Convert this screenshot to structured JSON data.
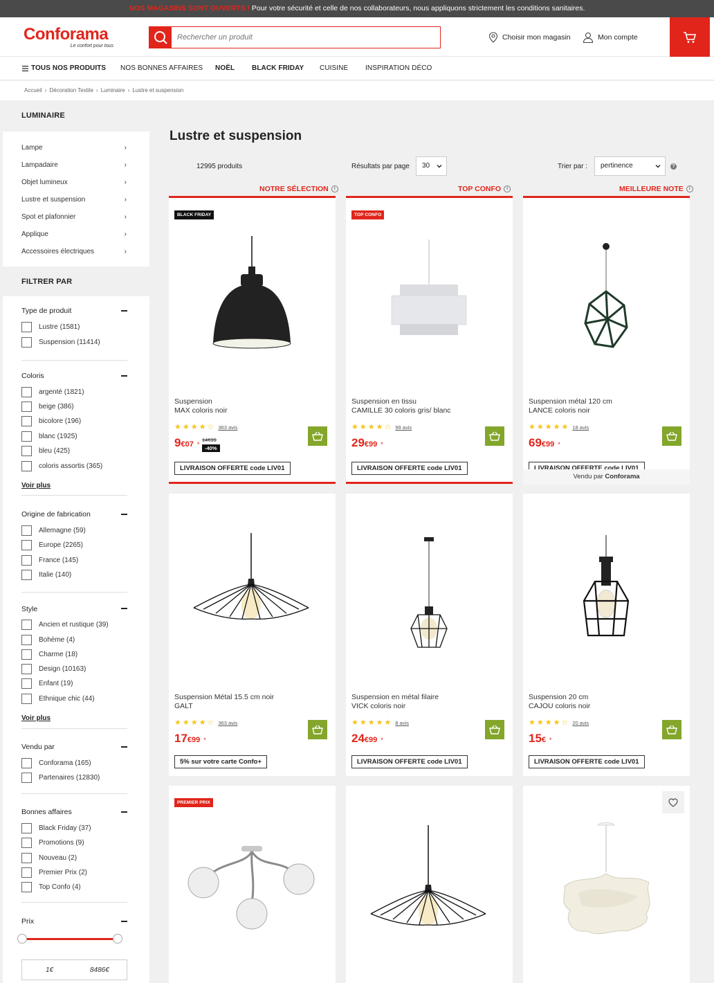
{
  "topbar": {
    "alert": "NOS MAGASINS SONT OUVERTS !",
    "message": " Pour votre sécurité et celle de nos collaborateurs, nous appliquons strictement les conditions sanitaires."
  },
  "header": {
    "brand": "Conforama",
    "tagline": "Le confort pour tous",
    "search_placeholder": "Rechercher un produit",
    "store_label": "Choisir mon magasin",
    "account_label": "Mon compte"
  },
  "nav": {
    "all_products": "TOUS NOS PRODUITS",
    "items": [
      "NOS BONNES AFFAIRES",
      "NOËL",
      "BLACK FRIDAY",
      "CUISINE",
      "INSPIRATION DÉCO"
    ]
  },
  "breadcrumb": [
    "Accueil",
    "Décoration Textile",
    "Luminaire",
    "Lustre et suspension"
  ],
  "sidebar": {
    "title": "LUMINAIRE",
    "categories": [
      "Lampe",
      "Lampadaire",
      "Objet lumineux",
      "Lustre et suspension",
      "Spot et plafonnier",
      "Applique",
      "Accessoires électriques"
    ],
    "filter_title": "FILTRER PAR",
    "groups": {
      "type": {
        "title": "Type de produit",
        "options": [
          "Lustre (1581)",
          "Suspension (11414)"
        ]
      },
      "coloris": {
        "title": "Coloris",
        "options": [
          "argenté (1821)",
          "beige (386)",
          "bicolore (196)",
          "blanc (1925)",
          "bleu (425)",
          "coloris assortis (365)"
        ],
        "more": "Voir plus"
      },
      "origine": {
        "title": "Origine de fabrication",
        "options": [
          "Allemagne (59)",
          "Europe (2265)",
          "France (145)",
          "Italie (140)"
        ]
      },
      "style": {
        "title": "Style",
        "options": [
          "Ancien et rustique (39)",
          "Bohème (4)",
          "Charme (18)",
          "Design (10163)",
          "Enfant (19)",
          "Ethnique chic (44)"
        ],
        "more": "Voir plus"
      },
      "vendu": {
        "title": "Vendu par",
        "options": [
          "Conforama (165)",
          "Partenaires (12830)"
        ]
      },
      "bonnes": {
        "title": "Bonnes affaires",
        "options": [
          "Black Friday (37)",
          "Promotions (9)",
          "Nouveau (2)",
          "Premier Prix (2)",
          "Top Confo (4)"
        ]
      },
      "prix": {
        "title": "Prix",
        "min": "1€",
        "max": "8486€"
      }
    }
  },
  "listing": {
    "title": "Lustre et suspension",
    "count": "12995 produits",
    "per_page_label": "Résultats par page",
    "per_page_value": "30",
    "sort_label": "Trier par :",
    "sort_value": "pertinence",
    "highlights": [
      "NOTRE SÉLECTION",
      "TOP CONFO",
      "MEILLEURE NOTE"
    ]
  },
  "products": [
    {
      "badge": "BLACK FRIDAY",
      "name1": "Suspension",
      "name2": "MAX coloris noir",
      "stars": 4.5,
      "reviews": "363 avis",
      "price_int": "9",
      "price_dec": "€07",
      "old_price": "14€99",
      "discount": "-40%",
      "promo": "LIVRAISON OFFERTE code LIV01"
    },
    {
      "badge": "TOP CONFO",
      "name1": "Suspension en tissu",
      "name2": "CAMILLE 30 coloris gris/ blanc",
      "stars": 4.5,
      "reviews": "99 avis",
      "price_int": "29",
      "price_dec": "€99",
      "promo": "LIVRAISON OFFERTE code LIV01"
    },
    {
      "name1": "Suspension métal 120 cm",
      "name2": "LANCE coloris noir",
      "stars": 5,
      "reviews": "18 avis",
      "price_int": "69",
      "price_dec": "€99",
      "promo": "LIVRAISON OFFERTE code LIV01",
      "sold_by": "Vendu par",
      "seller": "Conforama"
    },
    {
      "name1": "Suspension Métal 15.5 cm noir",
      "name2": "GALT",
      "stars": 4.5,
      "reviews": "363 avis",
      "price_int": "17",
      "price_dec": "€99",
      "promo": "5% sur votre carte Confo+"
    },
    {
      "name1": "Suspension en métal filaire",
      "name2": "VICK coloris noir",
      "stars": 5,
      "reviews": "8 avis",
      "price_int": "24",
      "price_dec": "€99",
      "promo": "LIVRAISON OFFERTE code LIV01"
    },
    {
      "name1": "Suspension 20 cm",
      "name2": "CAJOU coloris noir",
      "stars": 4,
      "reviews": "20 avis",
      "price_int": "15",
      "price_dec": "€",
      "promo": "LIVRAISON OFFERTE code LIV01"
    },
    {
      "badge": "PREMIER PRIX"
    },
    {},
    {}
  ],
  "colors": {
    "brand_red": "#e1251b",
    "basket_green": "#83a62b",
    "star_yellow": "#f5c518"
  }
}
